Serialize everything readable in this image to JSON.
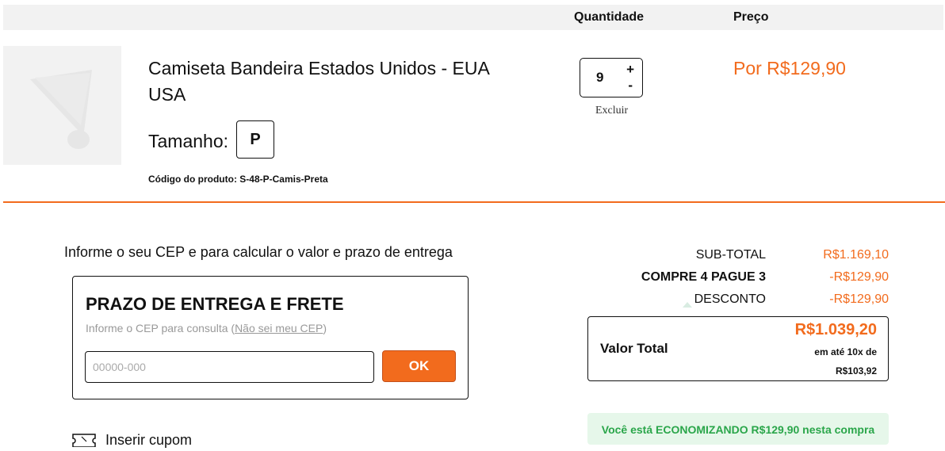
{
  "header": {
    "quantity_label": "Quantidade",
    "price_label": "Preço"
  },
  "product": {
    "name": "Camiseta Bandeira Estados Unidos - EUA USA",
    "size_label": "Tamanho:",
    "size_value": "P",
    "code_text": "Código do produto: S-48-P-Camis-Preta",
    "quantity": "9",
    "plus": "+",
    "minus": "-",
    "remove_label": "Excluir",
    "price": "Por R$129,90"
  },
  "shipping": {
    "info": "Informe o seu CEP e para calcular o valor e prazo de entrega",
    "title": "PRAZO DE ENTREGA E FRETE",
    "subtitle_prefix": "Informe o CEP para consulta (",
    "subtitle_link": "Não sei meu CEP",
    "subtitle_suffix": ")",
    "placeholder": "00000-000",
    "button": "OK"
  },
  "coupon": {
    "label": "Inserir cupom"
  },
  "summary": {
    "subtotal_label": "SUB-TOTAL",
    "subtotal_value": "R$1.169,10",
    "promo_label": "COMPRE 4 PAGUE 3",
    "promo_value": "-R$129,90",
    "discount_label": "DESCONTO",
    "discount_value": "-R$129,90",
    "total_label": "Valor Total",
    "total_value": "R$1.039,20",
    "installments_text": "em até 10x de",
    "installment_value": "R$103,92",
    "savings_message": "Você está ECONOMIZANDO R$129,90 nesta compra"
  },
  "colors": {
    "accent": "#f26b1d",
    "savings_bg": "#e6f7ea",
    "savings_text": "#2aa64a"
  }
}
